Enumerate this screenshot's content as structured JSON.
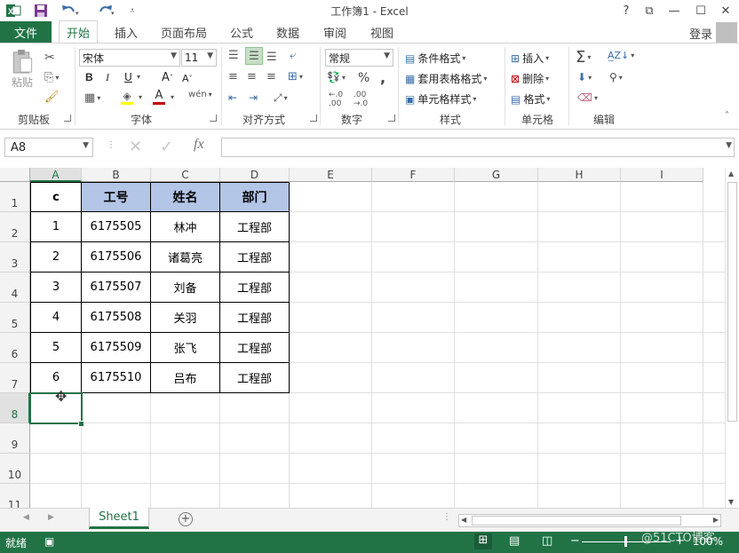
{
  "window": {
    "title": "工作簿1 - Excel",
    "help": "?",
    "restore": "⧉",
    "minimize": "—",
    "maximize": "☐",
    "close": "✕"
  },
  "quick_access": {
    "undo_icon": "undo-icon",
    "redo_icon": "redo-icon",
    "save_icon": "save-icon"
  },
  "tabs": {
    "file": "文件",
    "items": [
      "开始",
      "插入",
      "页面布局",
      "公式",
      "数据",
      "审阅",
      "视图"
    ],
    "active": "开始",
    "login": "登录"
  },
  "ribbon": {
    "clipboard": {
      "paste": "粘贴",
      "label": "剪贴板"
    },
    "font": {
      "name": "宋体",
      "size": "11",
      "bold": "B",
      "italic": "I",
      "underline": "U",
      "grow": "A",
      "shrink": "A",
      "label": "字体",
      "wen": "wén"
    },
    "alignment": {
      "label": "对齐方式"
    },
    "number": {
      "format": "常规",
      "percent": "%",
      "comma": ",",
      "label": "数字"
    },
    "styles": {
      "conditional": "条件格式",
      "table": "套用表格格式",
      "cell": "单元格样式",
      "label": "样式"
    },
    "cells": {
      "insert": "插入",
      "delete": "删除",
      "format": "格式",
      "label": "单元格"
    },
    "editing": {
      "label": "编辑"
    }
  },
  "formula_bar": {
    "name_box": "A8",
    "fx": "fx",
    "content": ""
  },
  "columns": [
    "A",
    "B",
    "C",
    "D",
    "E",
    "F",
    "G",
    "H",
    "I"
  ],
  "rows": [
    "1",
    "2",
    "3",
    "4",
    "5",
    "6",
    "7",
    "8",
    "9",
    "10",
    "11"
  ],
  "selected": {
    "column": "A",
    "row": "8"
  },
  "table": {
    "header": [
      "c",
      "工号",
      "姓名",
      "部门"
    ],
    "rows": [
      [
        "1",
        "6175505",
        "林冲",
        "工程部"
      ],
      [
        "2",
        "6175506",
        "诸葛亮",
        "工程部"
      ],
      [
        "3",
        "6175507",
        "刘备",
        "工程部"
      ],
      [
        "4",
        "6175508",
        "关羽",
        "工程部"
      ],
      [
        "5",
        "6175509",
        "张飞",
        "工程部"
      ],
      [
        "6",
        "6175510",
        "吕布",
        "工程部"
      ]
    ]
  },
  "sheets": {
    "active": "Sheet1",
    "add": "+"
  },
  "status": {
    "ready": "就绪",
    "zoom": "100%",
    "watermark": "@51CTO博客"
  },
  "colors": {
    "accent": "#217346",
    "header_fill": "#b4c6e7",
    "font_red": "#c00000",
    "highlight_yellow": "#ffff00"
  }
}
